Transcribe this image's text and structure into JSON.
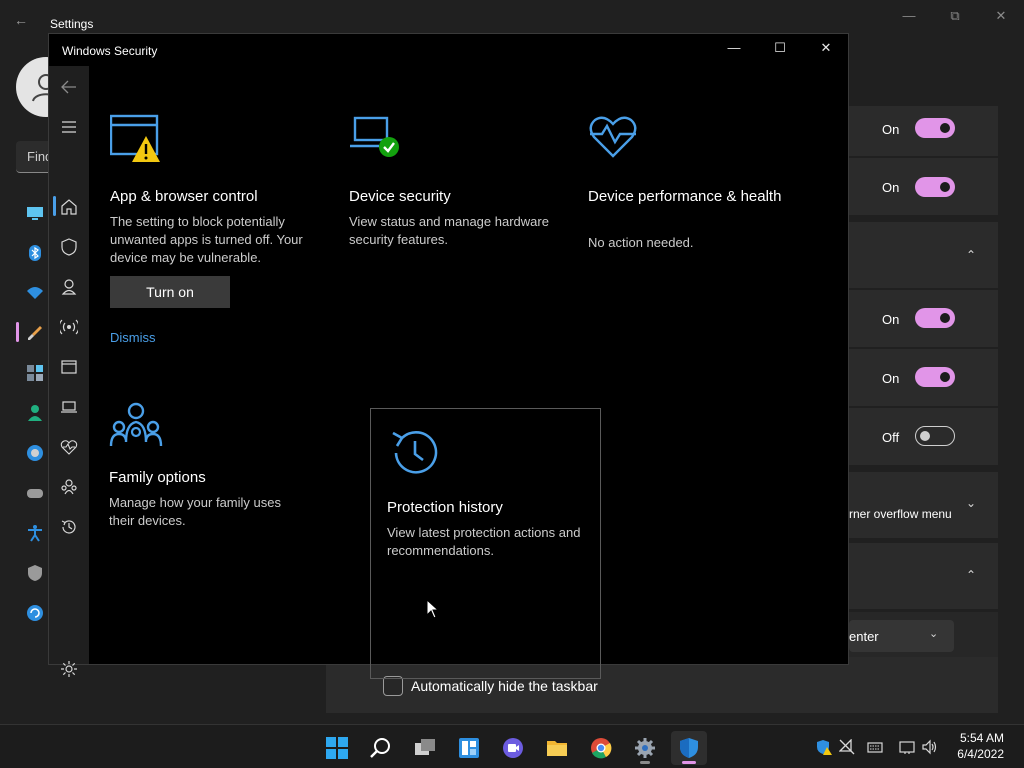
{
  "settings": {
    "title": "Settings",
    "search_placeholder": "Find",
    "rows": [
      {
        "state_label": "On"
      },
      {
        "state_label": "On"
      },
      {
        "state_label": "On"
      },
      {
        "state_label": "On"
      },
      {
        "state_label": "Off"
      }
    ],
    "overflow_label": "rner overflow menu",
    "alignment_value": "enter",
    "auto_hide_label": "Automatically hide the taskbar"
  },
  "security": {
    "title": "Windows Security",
    "tiles": {
      "app_browser": {
        "title": "App & browser control",
        "desc": "The setting to block potentially unwanted apps is turned off. Your device may be vulnerable.",
        "button": "Turn on",
        "link": "Dismiss"
      },
      "device_security": {
        "title": "Device security",
        "desc": "View status and manage hardware security features."
      },
      "device_performance": {
        "title": "Device performance & health",
        "desc": "No action needed."
      },
      "family": {
        "title": "Family options",
        "desc": "Manage how your family uses their devices."
      },
      "protection_history": {
        "title": "Protection history",
        "desc": "View latest protection actions and recommendations."
      }
    }
  },
  "taskbar": {
    "apps": [
      "start",
      "search",
      "task-view",
      "widgets",
      "teams-chat",
      "file-explorer",
      "chrome",
      "settings",
      "windows-security"
    ],
    "active_app": "windows-security",
    "time": "5:54 AM",
    "date": "6/4/2022"
  },
  "colors": {
    "accent_pink": "#e195e8",
    "security_blue": "#4a9fe8",
    "warning_yellow": "#f2c811",
    "ok_green": "#13a10e"
  }
}
